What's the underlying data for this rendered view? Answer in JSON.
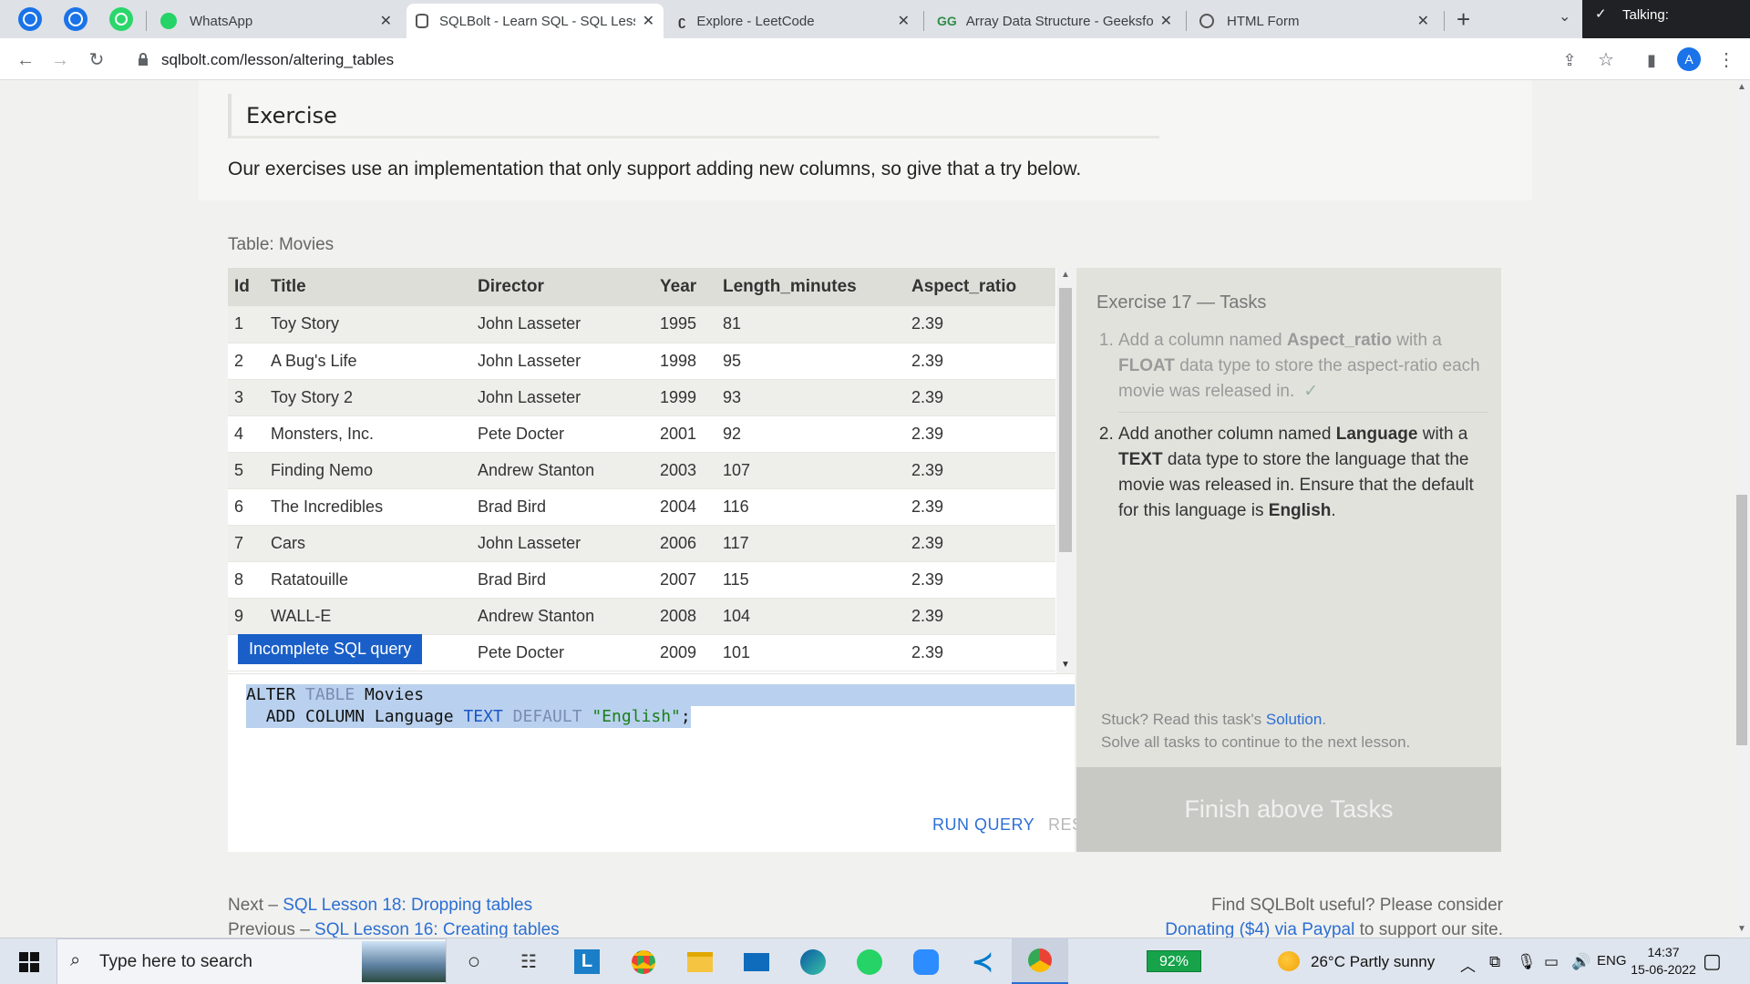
{
  "browser": {
    "tabs": [
      {
        "title": "WhatsApp",
        "active": false
      },
      {
        "title": "SQLBolt - Learn SQL - SQL Less",
        "active": true
      },
      {
        "title": "Explore - LeetCode",
        "active": false
      },
      {
        "title": "Array Data Structure - Geeksfor",
        "active": false
      },
      {
        "title": "HTML Form",
        "active": false
      }
    ],
    "talking_label": "Talking:",
    "url": "sqlbolt.com/lesson/altering_tables",
    "profile_initial": "A"
  },
  "lesson": {
    "exercise_heading": "Exercise",
    "intro": "Our exercises use an implementation that only support adding new columns, so give that a try below.",
    "table_label": "Table: Movies"
  },
  "movies_table": {
    "columns": [
      "Id",
      "Title",
      "Director",
      "Year",
      "Length_minutes",
      "Aspect_ratio"
    ],
    "rows": [
      [
        "1",
        "Toy Story",
        "John Lasseter",
        "1995",
        "81",
        "2.39"
      ],
      [
        "2",
        "A Bug's Life",
        "John Lasseter",
        "1998",
        "95",
        "2.39"
      ],
      [
        "3",
        "Toy Story 2",
        "John Lasseter",
        "1999",
        "93",
        "2.39"
      ],
      [
        "4",
        "Monsters, Inc.",
        "Pete Docter",
        "2001",
        "92",
        "2.39"
      ],
      [
        "5",
        "Finding Nemo",
        "Andrew Stanton",
        "2003",
        "107",
        "2.39"
      ],
      [
        "6",
        "The Incredibles",
        "Brad Bird",
        "2004",
        "116",
        "2.39"
      ],
      [
        "7",
        "Cars",
        "John Lasseter",
        "2006",
        "117",
        "2.39"
      ],
      [
        "8",
        "Ratatouille",
        "Brad Bird",
        "2007",
        "115",
        "2.39"
      ],
      [
        "9",
        "WALL-E",
        "Andrew Stanton",
        "2008",
        "104",
        "2.39"
      ],
      [
        "",
        "",
        "Pete Docter",
        "2009",
        "101",
        "2.39"
      ]
    ]
  },
  "tooltip": "Incomplete SQL query",
  "editor": {
    "line1": {
      "kw1": "ALTER",
      "kw2": "TABLE",
      "rest": " Movies"
    },
    "line2": {
      "indent": "  ",
      "kw1": "ADD COLUMN",
      "mid": " Language ",
      "kw2": "TEXT",
      "kw3": "DEFAULT",
      "str": "\"English\"",
      "end": ";"
    },
    "run_label": "RUN QUERY",
    "reset_label": "RESET"
  },
  "tasks": {
    "title": "Exercise 17 — Tasks",
    "task1": {
      "a": "Add a column named ",
      "b": "Aspect_ratio",
      "c": " with a ",
      "d": "FLOAT",
      "e": " data type to store the aspect-ratio each movie was released in.",
      "check": "✓"
    },
    "task2": {
      "a": "Add another column named ",
      "b": "Language",
      "c": " with a ",
      "d": "TEXT",
      "e": " data type to store the language that the movie was released in. Ensure that the default for this language is ",
      "f": "English",
      "g": "."
    },
    "stuck_prefix": "Stuck? Read this task's ",
    "solution_link": "Solution",
    "stuck_suffix": ".",
    "solve_all": "Solve all tasks to continue to the next lesson.",
    "finish_button": "Finish above Tasks"
  },
  "footer": {
    "next_prefix": "Next – ",
    "next_link": "SQL Lesson 18: Dropping tables",
    "prev_prefix": "Previous – ",
    "prev_link": "SQL Lesson 16: Creating tables",
    "useful": "Find SQLBolt useful? Please consider",
    "donate_link": "Donating ($4) via Paypal",
    "donate_suffix": " to support our site."
  },
  "taskbar": {
    "search_placeholder": "Type here to search",
    "battery": "92%",
    "weather": "26°C  Partly sunny",
    "language": "ENG",
    "time": "14:37",
    "date": "15-06-2022"
  },
  "colors": {
    "accent": "#2c6fd3",
    "tooltip": "#1a5fc8",
    "battery": "#16a34a"
  }
}
